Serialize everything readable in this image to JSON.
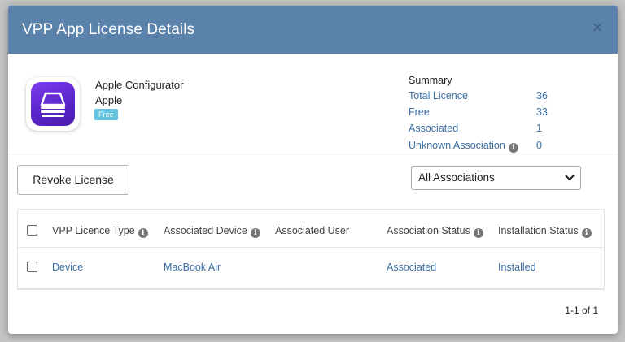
{
  "modal": {
    "title": "VPP App License Details",
    "close_glyph": "×"
  },
  "app": {
    "name": "Apple Configurator",
    "vendor": "Apple",
    "badge": "Free"
  },
  "summary": {
    "title": "Summary",
    "rows": [
      {
        "label": "Total Licence",
        "value": "36"
      },
      {
        "label": "Free",
        "value": "33"
      },
      {
        "label": "Associated",
        "value": "1"
      },
      {
        "label": "Unknown Association",
        "value": "0",
        "info": true
      }
    ]
  },
  "actions": {
    "revoke_label": "Revoke License",
    "filter_selected": "All Associations"
  },
  "table": {
    "columns": [
      {
        "label": "VPP Licence Type",
        "info": true
      },
      {
        "label": "Associated Device",
        "info": true
      },
      {
        "label": "Associated User",
        "info": false
      },
      {
        "label": "Association Status",
        "info": true
      },
      {
        "label": "Installation Status",
        "info": true
      }
    ],
    "rows": [
      {
        "type": "Device",
        "device": "MacBook Air",
        "user": "",
        "association_status": "Associated",
        "installation_status": "Installed"
      }
    ]
  },
  "pagination": {
    "text": "1-1 of 1"
  },
  "colors": {
    "header_bg": "#5b82aa",
    "link": "#3a6fa6",
    "badge": "#64c3e0",
    "icon_purple": "#6a30e0"
  },
  "info_glyph": "i"
}
